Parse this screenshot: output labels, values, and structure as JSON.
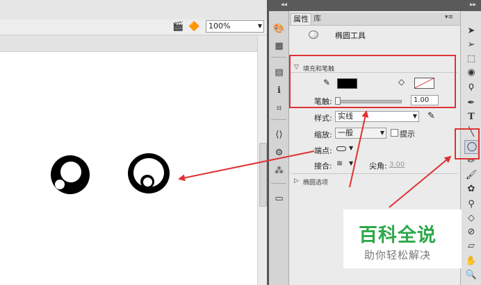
{
  "stage": {
    "zoom_value": "100%"
  },
  "panel": {
    "tabs": [
      "属性",
      "库"
    ],
    "tool_name": "椭圆工具",
    "fill_stroke": {
      "section_label": "填充和笔触",
      "stroke_color": "#000000",
      "fill_color": "none"
    },
    "stroke_size": {
      "label": "笔触:",
      "value": "1.00"
    },
    "style": {
      "label": "样式:",
      "value": "实线"
    },
    "scale": {
      "label": "缩放:",
      "value": "一般",
      "hint_label": "提示",
      "hint_checked": false
    },
    "cap": {
      "label": "端点:"
    },
    "join": {
      "label": "接合:",
      "miter_label": "尖角:",
      "miter_value": "3.00"
    },
    "oval_options": {
      "section_label": "椭圆选项"
    }
  },
  "watermark": {
    "title": "百科全说",
    "subtitle": "助你轻松解决"
  },
  "colors": {
    "annotation_red": "#e03030",
    "watermark_green": "#2ea84a"
  }
}
